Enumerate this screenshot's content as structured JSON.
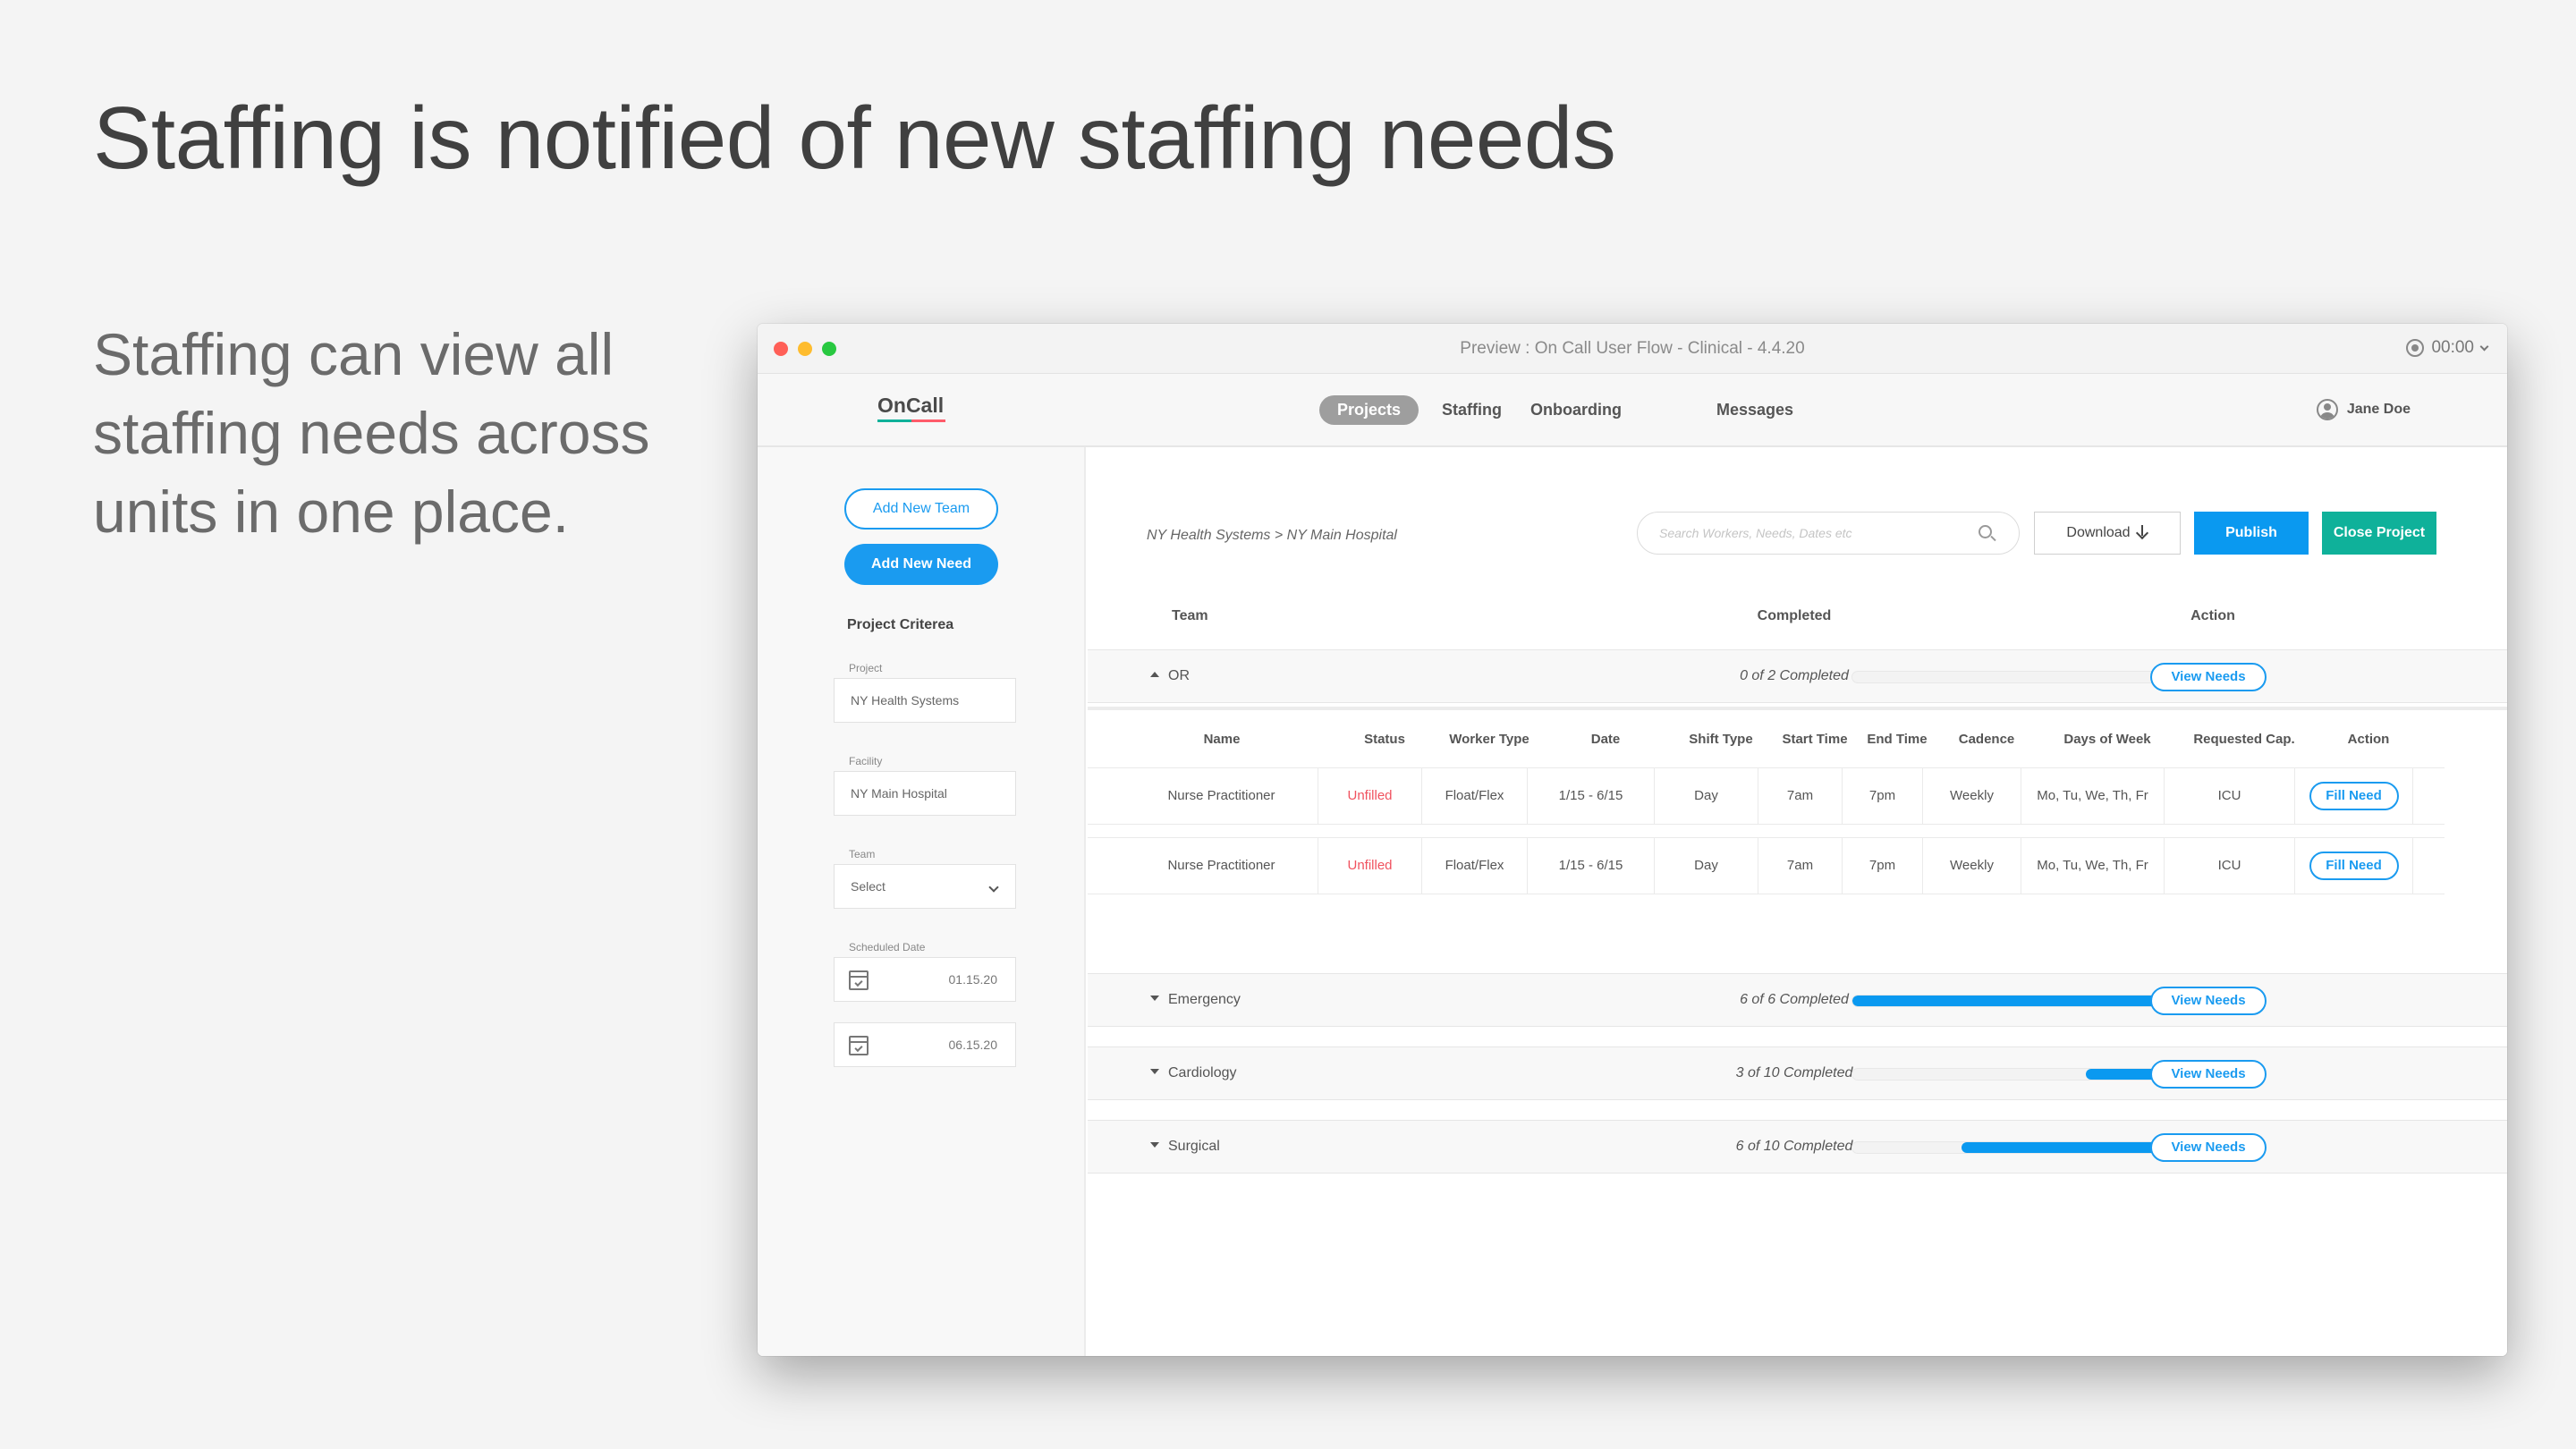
{
  "slide": {
    "title": "Staffing is notified of new staffing needs",
    "text": "Staffing can view all staffing needs across units in one place."
  },
  "window": {
    "title": "Preview : On Call User Flow - Clinical - 4.4.20",
    "timer": "00:00"
  },
  "nav": {
    "logo": "OnCall",
    "items": [
      "Projects",
      "Staffing",
      "Onboarding",
      "Messages"
    ],
    "active": "Projects",
    "user": "Jane Doe"
  },
  "sidebar": {
    "add_team": "Add New Team",
    "add_need": "Add New Need",
    "criteria_heading": "Project Criterea",
    "project_label": "Project",
    "project_value": "NY Health Systems",
    "facility_label": "Facility",
    "facility_value": "NY Main Hospital",
    "team_label": "Team",
    "team_value": "Select",
    "date_label": "Scheduled Date",
    "start_date": "01.15.20",
    "end_date": "06.15.20"
  },
  "toolbar": {
    "breadcrumb": "NY Health Systems > NY Main Hospital",
    "search_placeholder": "Search Workers, Needs, Dates etc",
    "download": "Download",
    "publish": "Publish",
    "close": "Close Project"
  },
  "teams_table": {
    "headers": [
      "Team",
      "Completed",
      "Action"
    ],
    "view_label": "View Needs",
    "teams": [
      {
        "name": "OR",
        "completed": "0 of 2 Completed",
        "progress": 0.0,
        "expanded": true
      },
      {
        "name": "Emergency",
        "completed": "6 of 6 Completed",
        "progress": 1.0,
        "expanded": false
      },
      {
        "name": "Cardiology",
        "completed": "3 of 10 Completed",
        "progress": 0.27,
        "expanded": false
      },
      {
        "name": "Surgical",
        "completed": "6 of 10 Completed",
        "progress": 0.66,
        "expanded": false
      }
    ]
  },
  "needs_table": {
    "headers": [
      "Name",
      "Status",
      "Worker Type",
      "Date",
      "Shift Type",
      "Start Time",
      "End Time",
      "Cadence",
      "Days of Week",
      "Requested Cap.",
      "Action"
    ],
    "rows": [
      [
        "Nurse Practitioner",
        "Unfilled",
        "Float/Flex",
        "1/15 - 6/15",
        "Day",
        "7am",
        "7pm",
        "Weekly",
        "Mo, Tu, We, Th, Fr",
        "ICU",
        "Fill Need"
      ],
      [
        "Nurse Practitioner",
        "Unfilled",
        "Float/Flex",
        "1/15 - 6/15",
        "Day",
        "7am",
        "7pm",
        "Weekly",
        "Mo, Tu, We, Th, Fr",
        "ICU",
        "Fill Need"
      ]
    ]
  },
  "colors": {
    "accent_blue": "#0a99f0",
    "teal": "#0fb19a",
    "unfilled_red": "#f0525f"
  }
}
